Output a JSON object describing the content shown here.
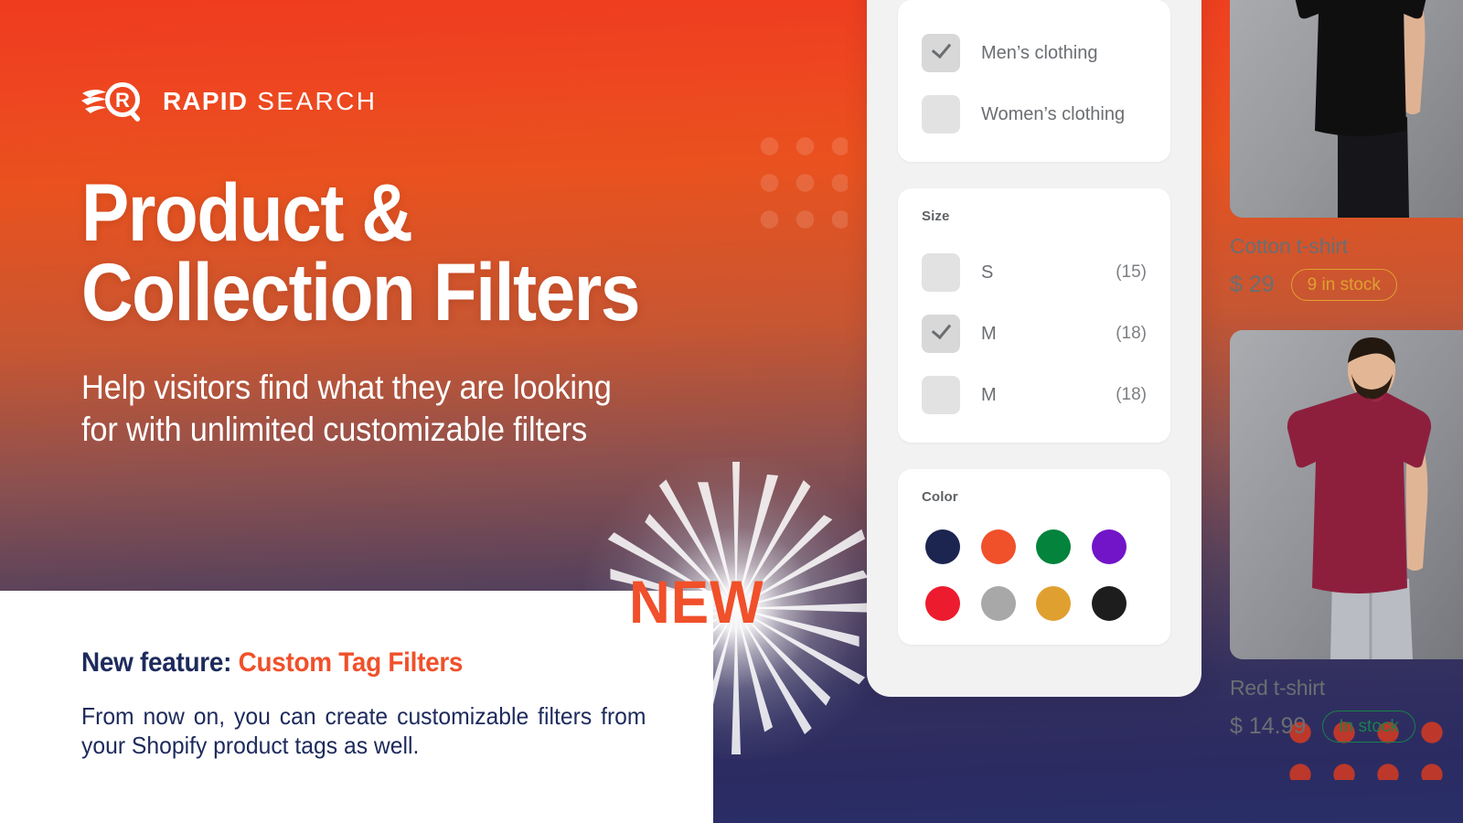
{
  "brand": {
    "name_bold": "RAPID",
    "name_light": " SEARCH",
    "logo_icon": "magnifier-r-icon"
  },
  "hero": {
    "headline_line1": "Product &",
    "headline_line2": "Collection Filters",
    "subhead_line1": "Help visitors find what they are looking",
    "subhead_line2": "for with unlimited customizable filters",
    "new_badge": "NEW"
  },
  "announcement": {
    "feature_label": "New feature:",
    "feature_name": "Custom Tag Filters",
    "body": "From now on, you can create customizable filters from your Shopify product tags as well."
  },
  "filters": {
    "category_card": {
      "options": [
        {
          "label": "Men’s clothing",
          "checked": true
        },
        {
          "label": "Women’s clothing",
          "checked": false
        }
      ]
    },
    "size_card": {
      "title": "Size",
      "options": [
        {
          "label": "S",
          "count": "(15)",
          "checked": false
        },
        {
          "label": "M",
          "count": "(18)",
          "checked": true
        },
        {
          "label": "M",
          "count": "(18)",
          "checked": false
        }
      ]
    },
    "color_card": {
      "title": "Color",
      "swatches": [
        {
          "name": "navy",
          "hex": "#1c2450"
        },
        {
          "name": "orange",
          "hex": "#f0502a"
        },
        {
          "name": "green",
          "hex": "#03833c"
        },
        {
          "name": "purple",
          "hex": "#7214c8"
        },
        {
          "name": "red",
          "hex": "#ed1b2e"
        },
        {
          "name": "gray",
          "hex": "#a8a8a8"
        },
        {
          "name": "amber",
          "hex": "#e0a030"
        },
        {
          "name": "black",
          "hex": "#1d1d1d"
        }
      ]
    }
  },
  "products": [
    {
      "name": "Cotton t-shirt",
      "price": "$ 29",
      "stock": "9 in stock",
      "stock_color": "#e0a030",
      "shirt_color": "#100f10",
      "pants_color": "#15151a"
    },
    {
      "name": "Red t-shirt",
      "price": "$ 14.99",
      "stock": "In stock",
      "stock_color": "#17824a",
      "shirt_color": "#8d1f3d",
      "pants_color": "#b9bcc2"
    }
  ],
  "theme": {
    "gradient_top": "#ef3b1f",
    "gradient_bottom": "#2a2f68",
    "accent_orange": "#f0502a",
    "navy_text": "#1d2a5c",
    "panel_bg": "#f2f2f2"
  }
}
